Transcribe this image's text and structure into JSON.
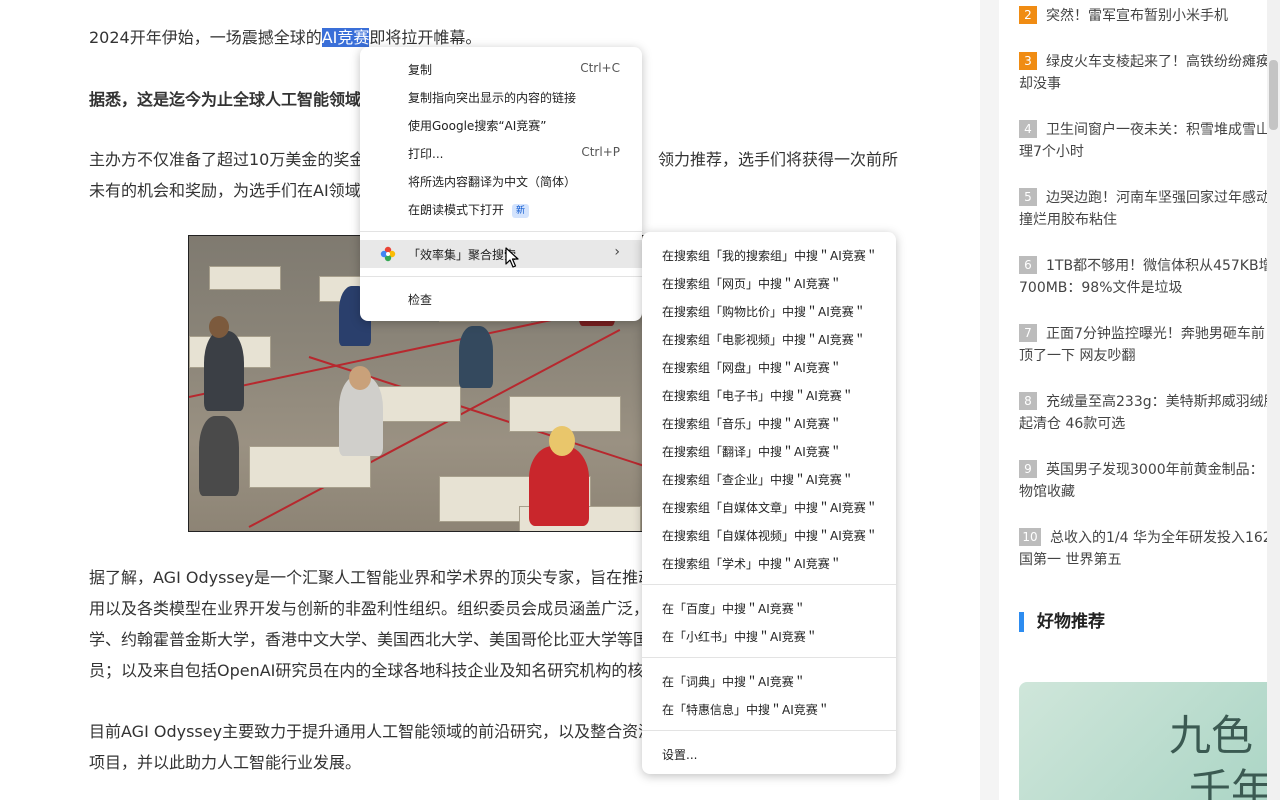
{
  "article": {
    "p1_before": "2024开年伊始，一场震撼全球的",
    "p1_highlight": "AI竞赛",
    "p1_after": "即将拉开帷幕。",
    "p2": "据悉，这是迄今为止全球人工智能领域",
    "p3_line1": "主办方不仅准备了超过10万美金的奖金",
    "p3_line1_right": "领力推荐，选手们将获得一次前所",
    "p3_line2": "未有的机会和奖励，为选手们在AI领域",
    "p4_line1": "据了解，AGI Odyssey是一个汇聚人工智能业界和学术界的顶尖专家，旨在推动",
    "p4_line2": "用以及各类模型在业界开发与创新的非盈利性组织。组织委员会成员涵盖广泛，",
    "p4_line3": "学、约翰霍普金斯大学，香港中文大学、美国西北大学、美国哥伦比亚大学等国",
    "p4_line4": "员；以及来自包括OpenAI研究员在内的全球各地科技企业及知名研究机构的核",
    "p5_line1": "目前AGI Odyssey主要致力于提升通用人工智能领域的前沿研究，以及整合资源",
    "p5_line2": "项目，并以此助力人工智能行业发展。"
  },
  "sidebar": {
    "rank_items": [
      {
        "num": "2",
        "line1": "突然！雷军宣布暂别小米手机",
        "line2": ""
      },
      {
        "num": "3",
        "line1": "绿皮火车支棱起来了！高铁纷纷瘫痪",
        "line2": "却没事"
      },
      {
        "num": "4",
        "line1": "卫生间窗户一夜未关：积雪堆成雪山",
        "line2": "理7个小时"
      },
      {
        "num": "5",
        "line1": "边哭边跑！河南车坚强回家过年感动",
        "line2": "撞烂用胶布粘住"
      },
      {
        "num": "6",
        "line1": "1TB都不够用！微信体积从457KB增",
        "line2": "700MB：98%文件是垃圾"
      },
      {
        "num": "7",
        "line1": "正面7分钟监控曝光！奔驰男砸车前",
        "line2": "顶了一下 网友吵翻"
      },
      {
        "num": "8",
        "line1": "充绒量至高233g：美特斯邦威羽绒服",
        "line2": "起清仓 46款可选"
      },
      {
        "num": "9",
        "line1": "英国男子发现3000年前黄金制品：",
        "line2": "物馆收藏"
      },
      {
        "num": "10",
        "line1": "总收入的1/4 华为全年研发投入162",
        "line2": "国第一 世界第五"
      }
    ],
    "section_title": "好物推荐",
    "promo_big": "九色",
    "promo_big2": "千年"
  },
  "context_menu": {
    "copy": "复制",
    "copy_shortcut": "Ctrl+C",
    "copy_link": "复制指向突出显示的内容的链接",
    "google_search": "使用Google搜索“AI竞赛”",
    "print": "打印...",
    "print_shortcut": "Ctrl+P",
    "translate": "将所选内容翻译为中文（简体）",
    "reader_mode": "在朗读模式下打开",
    "new_badge": "新",
    "aggregate_search": "「效率集」聚合搜索",
    "inspect": "检查"
  },
  "submenu": {
    "group_items": [
      "在搜索组「我的搜索组」中搜＂AI竞赛＂",
      "在搜索组「网页」中搜＂AI竞赛＂",
      "在搜索组「购物比价」中搜＂AI竞赛＂",
      "在搜索组「电影视频」中搜＂AI竞赛＂",
      "在搜索组「网盘」中搜＂AI竞赛＂",
      "在搜索组「电子书」中搜＂AI竞赛＂",
      "在搜索组「音乐」中搜＂AI竞赛＂",
      "在搜索组「翻译」中搜＂AI竞赛＂",
      "在搜索组「查企业」中搜＂AI竞赛＂",
      "在搜索组「自媒体文章」中搜＂AI竞赛＂",
      "在搜索组「自媒体视频」中搜＂AI竞赛＂",
      "在搜索组「学术」中搜＂AI竞赛＂"
    ],
    "engine_items": [
      "在「百度」中搜＂AI竞赛＂",
      "在「小红书」中搜＂AI竞赛＂"
    ],
    "tool_items": [
      "在「词典」中搜＂AI竞赛＂",
      "在「特惠信息」中搜＂AI竞赛＂"
    ],
    "settings": "设置..."
  }
}
